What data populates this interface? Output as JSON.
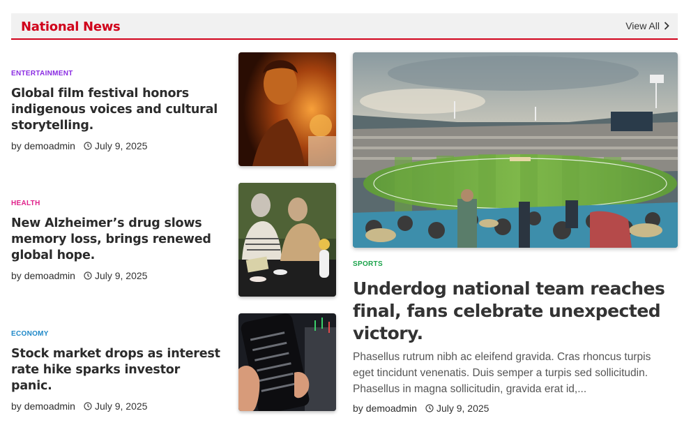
{
  "section": {
    "title": "National News",
    "view_all": "View All"
  },
  "articles": [
    {
      "category": "Entertainment",
      "title": "Global film festival honors indigenous voices and cultural storytelling.",
      "by": "by",
      "author": "demoadmin",
      "date": "July 9, 2025"
    },
    {
      "category": "Health",
      "title": "New Alzheimer’s drug slows memory loss, brings renewed global hope.",
      "by": "by",
      "author": "demoadmin",
      "date": "July 9, 2025"
    },
    {
      "category": "Economy",
      "title": "Stock market drops as interest rate hike sparks investor panic.",
      "by": "by",
      "author": "demoadmin",
      "date": "July 9, 2025"
    }
  ],
  "featured": {
    "category": "Sports",
    "title": "Underdog national team reaches final, fans celebrate unexpected victory.",
    "excerpt": "Phasellus rutrum nibh ac eleifend gravida. Cras rhoncus turpis eget tincidunt venenatis. Duis semper a turpis sed sollicitudin. Phasellus in magna sollicitudin, gravida erat id,...",
    "by": "by",
    "author": "demoadmin",
    "date": "July 9, 2025"
  },
  "colors": {
    "accent": "#d0021b",
    "entertainment": "#8a2be2",
    "health": "#e0218a",
    "economy": "#1e88c8",
    "sports": "#1aa34a"
  },
  "icons": {
    "view_all": "chevron-right-icon",
    "date": "clock-icon"
  }
}
